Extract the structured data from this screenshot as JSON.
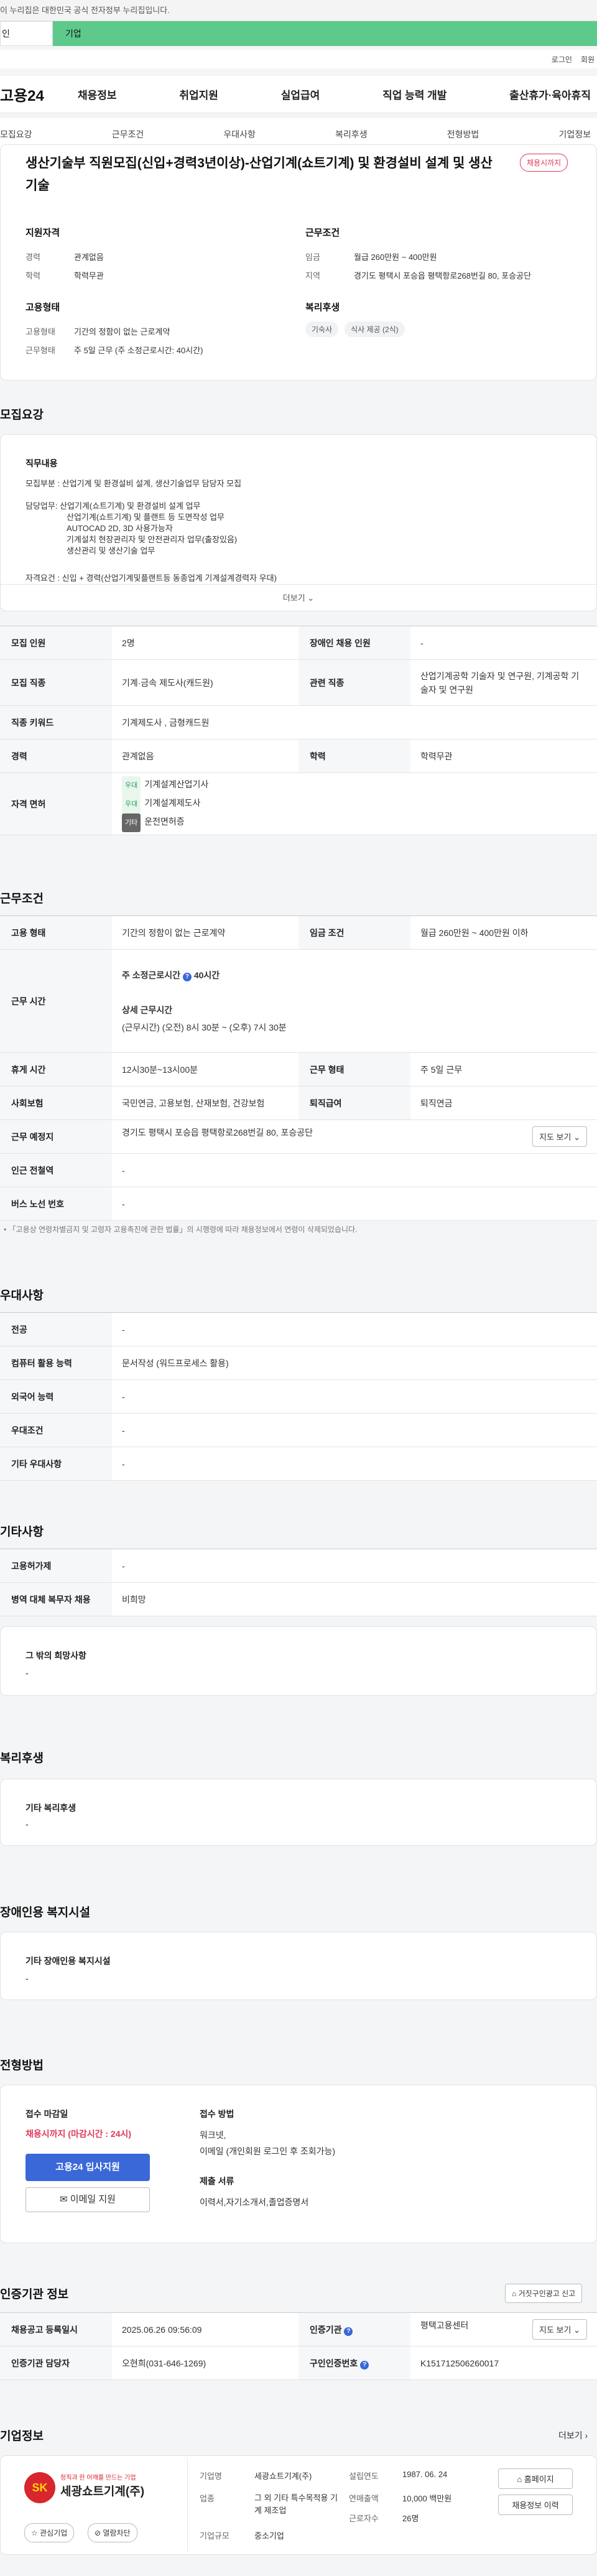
{
  "gov_notice": "이 누리집은 대한민국 공식 전자정부 누리집입니다.",
  "top_tabs": {
    "personal": "인",
    "company": "기업"
  },
  "util": {
    "login": "로그인",
    "join": "회원"
  },
  "logo": "고용24",
  "gnb": [
    "채용정보",
    "취업지원",
    "실업급여",
    "직업 능력 개발",
    "출산휴가·육아휴직"
  ],
  "anchors": [
    "모집요강",
    "근무조건",
    "우대사항",
    "복리후생",
    "전형방법",
    "기업정보"
  ],
  "job": {
    "title": "생산기술부 직원모집(신입+경력3년이상)-산업기계(쇼트기계) 및 환경설비 설계 및 생산기술",
    "status": "채용시까지",
    "qual_title": "지원자격",
    "qual": [
      {
        "k": "경력",
        "v": "관계없음"
      },
      {
        "k": "학력",
        "v": "학력무관"
      }
    ],
    "cond_title": "근무조건",
    "cond": [
      {
        "k": "임금",
        "v": "월급 260만원 ~ 400만원"
      },
      {
        "k": "지역",
        "v": "경기도 평택시 포승읍 평택항로268번길 80, 포승공단"
      }
    ],
    "emp_title": "고용형태",
    "emp": [
      {
        "k": "고용형태",
        "v": "기간의 정함이 없는 근로계약"
      },
      {
        "k": "근무형태",
        "v": "주 5일 근무 (주 소정근로시간: 40시간)"
      }
    ],
    "welfare_title": "복리후생",
    "welfare_chips": [
      "기숙사",
      "식사 제공 (2식)"
    ]
  },
  "recruit": {
    "heading": "모집요강",
    "duty_title": "직무내용",
    "duty_lines": [
      "모집부분 : 산업기계 및 환경설비 설계, 생산기술업무 담당자 모집",
      "담당업무: 산업기계(쇼트기계) 및 환경설비 설계 업무",
      "산업기계(쇼트기계) 및 플랜트 등 도면작성 업무",
      "AUTOCAD 2D, 3D 사용가능자",
      "기계설치 현장관리자 및 안전관리자 업무(출장있음)",
      "생산관리 및 생산기술 업무",
      "자격요건 : 신입 + 경력(산업기계및플랜트등 동종업계 기계설계경력자 우대)"
    ],
    "more": "더보기",
    "rows": {
      "count_k": "모집 인원",
      "count_v": "2명",
      "disabled_k": "장애인 채용 인원",
      "disabled_v": "-",
      "job_k": "모집 직종",
      "job_v": "기계·금속 제도사(캐드원)",
      "rel_k": "관련 직종",
      "rel_v": "산업기계공학 기술자 및 연구원, 기계공학 기술자 및 연구원",
      "kw_k": "직종 키워드",
      "kw_v": "기계제도사 , 금형캐드원",
      "career_k": "경력",
      "career_v": "관계없음",
      "edu_k": "학력",
      "edu_v": "학력무관",
      "license_k": "자격 면허",
      "licenses": [
        {
          "tag": "우대",
          "name": "기계설계산업기사"
        },
        {
          "tag": "우대",
          "name": "기계설계제도사"
        },
        {
          "tag": "기타",
          "name": "운전면허증"
        }
      ]
    }
  },
  "work": {
    "heading": "근무조건",
    "emp_k": "고용 형태",
    "emp_v": "기간의 정함이 없는 근로계약",
    "wage_k": "임금 조건",
    "wage_v": "월급 260만원 ~ 400만원 이하",
    "time_k": "근무 시간",
    "time_week": "주 소정근로시간",
    "time_week_v": "40시간",
    "time_detail_title": "상세 근무시간",
    "time_detail": "(근무시간) (오전) 8시 30분 ~ (오후) 7시 30분",
    "break_k": "휴게 시간",
    "break_v": "12시30분~13시00분",
    "form_k": "근무 형태",
    "form_v": "주 5일 근무",
    "ins_k": "사회보험",
    "ins_v": "국민연금, 고용보험, 산재보험, 건강보험",
    "pension_k": "퇴직급여",
    "pension_v": "퇴직연금",
    "place_k": "근무 예정지",
    "place_v": "경기도 평택시 포승읍 평택항로268번길 80, 포승공단",
    "map_btn": "지도 보기",
    "subway_k": "인근 전철역",
    "subway_v": "-",
    "bus_k": "버스 노선 번호",
    "bus_v": "-",
    "note": "「고용상 연령차별금지 및 고령자 고용촉진에 관한 법률」의 시행령에 따라 채용정보에서 연령이 삭제되었습니다."
  },
  "pref": {
    "heading": "우대사항",
    "rows": [
      {
        "k": "전공",
        "v": "-"
      },
      {
        "k": "컴퓨터 활용 능력",
        "v": "문서작성 (워드프로세스 활용)"
      },
      {
        "k": "외국어 능력",
        "v": "-"
      },
      {
        "k": "우대조건",
        "v": "-"
      },
      {
        "k": "기타 우대사항",
        "v": "-"
      }
    ]
  },
  "etc": {
    "heading": "기타사항",
    "rows": [
      {
        "k": "고용허가제",
        "v": "-"
      },
      {
        "k": "병역 대체 복무자 채용",
        "v": "비희망"
      }
    ],
    "box_title": "그 밖의 희망사항",
    "box_v": "-"
  },
  "welfare": {
    "heading": "복리후생",
    "box_title": "기타 복리후생",
    "box_v": "-"
  },
  "disabled": {
    "heading": "장애인용 복지시설",
    "box_title": "기타 장애인용 복지시설",
    "box_v": "-"
  },
  "process": {
    "heading": "전형방법",
    "deadline_title": "접수 마감일",
    "deadline_v": "채용시까지 (마감시간 : 24시)",
    "apply_btn": "고용24 입사지원",
    "email_btn": "이메일 지원",
    "method_title": "접수 방법",
    "method_lines": [
      "워크넷,",
      "이메일 (개인회원 로그인 후 조회가능)"
    ],
    "docs_title": "제출 서류",
    "docs_v": "이력서,자기소개서,졸업증명서"
  },
  "cert": {
    "heading": "인증기관 정보",
    "report_btn": "거짓구인광고 신고",
    "reg_k": "채용공고 등록일시",
    "reg_v": "2025.06.26 09:56:09",
    "org_k": "인증기관",
    "org_v": "평택고용센터",
    "map_btn": "지도 보기",
    "mgr_k": "인증기관 담당자",
    "mgr_v": "오현희(031-646-1269)",
    "no_k": "구인인증번호",
    "no_v": "K151712506260017"
  },
  "company": {
    "heading": "기업정보",
    "more": "더보기",
    "logo_slogan": "정직과 한 어깨를 만드는 기업",
    "logo_name": "세광쇼트기계(주)",
    "interest_btn": "관심기업",
    "block_btn": "열람차단",
    "info": [
      {
        "k": "기업명",
        "v": "세광쇼트기계(주)"
      },
      {
        "k": "업종",
        "v": "그 외 기타 특수목적용 기계 제조업"
      },
      {
        "k": "기업규모",
        "v": "중소기업"
      }
    ],
    "info2": [
      {
        "k": "설립연도",
        "v": "1987. 06. 24"
      },
      {
        "k": "연매출액",
        "v": "10,000 백만원"
      },
      {
        "k": "근로자수",
        "v": "26명"
      }
    ],
    "home_btn": "홈페이지",
    "list_btn": "채용정보 이력"
  },
  "colors": {
    "brand_green": "#5dc98a",
    "accent_blue": "#3a68d8",
    "status_red": "#e03a5a"
  }
}
